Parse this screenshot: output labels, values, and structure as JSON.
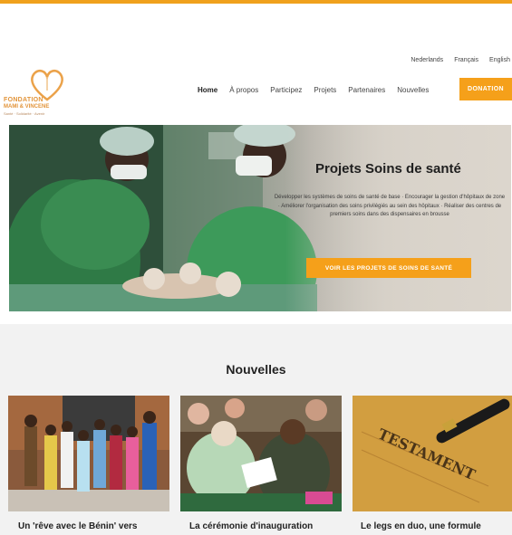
{
  "languages": [
    "Nederlands",
    "Français",
    "English"
  ],
  "logo": {
    "line1": "FONDATION",
    "line2": "MAMI & VINCENE",
    "line3": "Santé · Solidarité · Avenir"
  },
  "nav": {
    "items": [
      "Home",
      "À propos",
      "Participez",
      "Projets",
      "Partenaires",
      "Nouvelles"
    ],
    "donate_label": "DONATION"
  },
  "hero": {
    "title": "Projets Soins de santé",
    "description": "Développer les systèmes de soins de santé de base · Encourager la gestion d'hôpitaux de zone · Améliorer l'organisation des soins privilégiés au sein des hôpitaux · Réaliser des centres de premiers soins dans des dispensaires en brousse",
    "button_label": "VOIR LES PROJETS DE SOINS DE SANTÉ"
  },
  "news": {
    "title": "Nouvelles",
    "cards": [
      {
        "title": "Un 'rêve avec le Bénin' vers"
      },
      {
        "title": "La cérémonie d'inauguration"
      },
      {
        "title": "Le legs en duo, une formule"
      }
    ]
  },
  "colors": {
    "accent": "#f5a01a",
    "band": "#f2f2f2"
  }
}
